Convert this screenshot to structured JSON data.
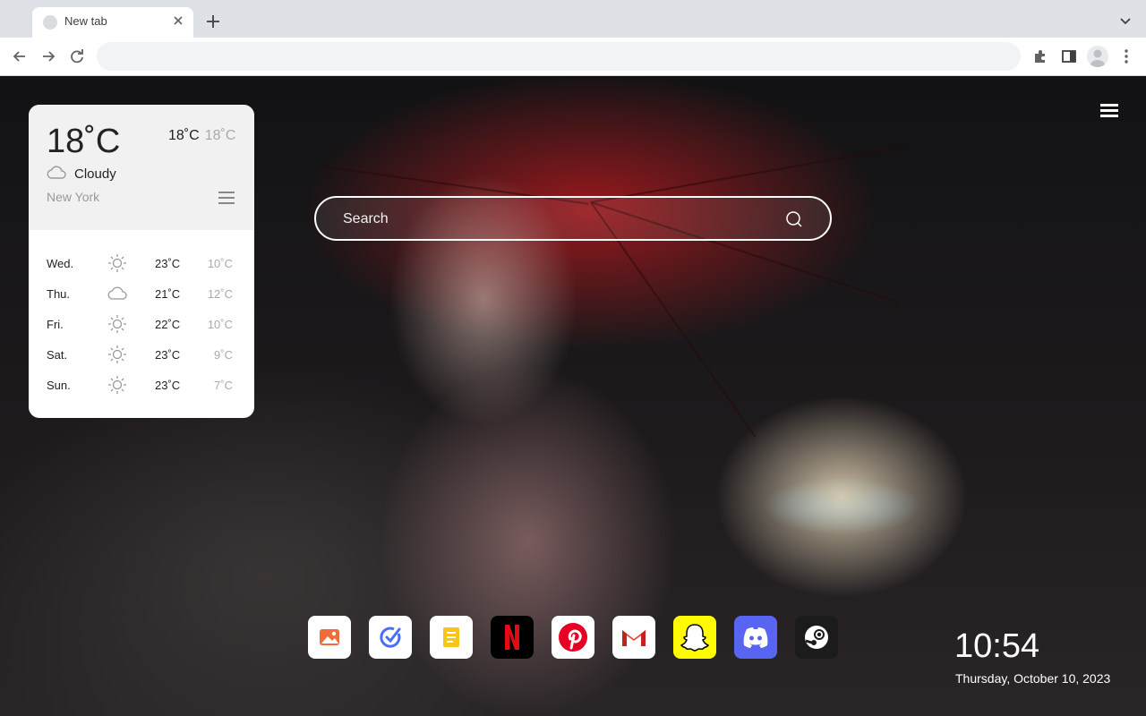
{
  "browser": {
    "tab": {
      "title": "New tab"
    },
    "omnibox": {
      "value": "",
      "placeholder": ""
    },
    "icons": {
      "tab_favicon": "globe-icon",
      "tab_close": "close-icon",
      "new_tab": "plus-icon",
      "tab_search": "chevron-down-icon",
      "back": "arrow-left-icon",
      "forward": "arrow-right-icon",
      "reload": "reload-icon",
      "extensions": "puzzle-icon",
      "side_panel": "side-panel-icon",
      "profile": "avatar-icon",
      "menu": "kebab-menu-icon"
    }
  },
  "weather": {
    "current_temp": "18˚C",
    "high": "18˚C",
    "low": "18˚C",
    "condition": "Cloudy",
    "condition_icon": "cloud-icon",
    "city": "New York",
    "forecast": [
      {
        "day": "Wed.",
        "icon": "sun-icon",
        "high": "23˚C",
        "low": "10˚C"
      },
      {
        "day": "Thu.",
        "icon": "cloud-icon",
        "high": "21˚C",
        "low": "12˚C"
      },
      {
        "day": "Fri.",
        "icon": "sun-icon",
        "high": "22˚C",
        "low": "10˚C"
      },
      {
        "day": "Sat.",
        "icon": "sun-icon",
        "high": "23˚C",
        "low": "9˚C"
      },
      {
        "day": "Sun.",
        "icon": "sun-icon",
        "high": "23˚C",
        "low": "7˚C"
      }
    ]
  },
  "search": {
    "placeholder": "Search"
  },
  "shortcuts": [
    {
      "name": "photos",
      "icon": "photos-icon",
      "color": "#f26b3a"
    },
    {
      "name": "tasks",
      "icon": "check-circle-icon",
      "color": "#4a6cf7"
    },
    {
      "name": "notes",
      "icon": "notes-icon",
      "color": "#f5c518"
    },
    {
      "name": "netflix",
      "icon": "netflix-icon",
      "color": "#e50914"
    },
    {
      "name": "pinterest",
      "icon": "pinterest-icon",
      "color": "#e60023"
    },
    {
      "name": "gmail",
      "icon": "gmail-icon",
      "color": "#ea4335"
    },
    {
      "name": "snapchat",
      "icon": "snapchat-icon",
      "color": "#fffc00"
    },
    {
      "name": "discord",
      "icon": "discord-icon",
      "color": "#5865f2"
    },
    {
      "name": "steam",
      "icon": "steam-icon",
      "color": "#1b1b1b"
    }
  ],
  "clock": {
    "time": "10:54",
    "date": "Thursday, October 10, 2023"
  }
}
